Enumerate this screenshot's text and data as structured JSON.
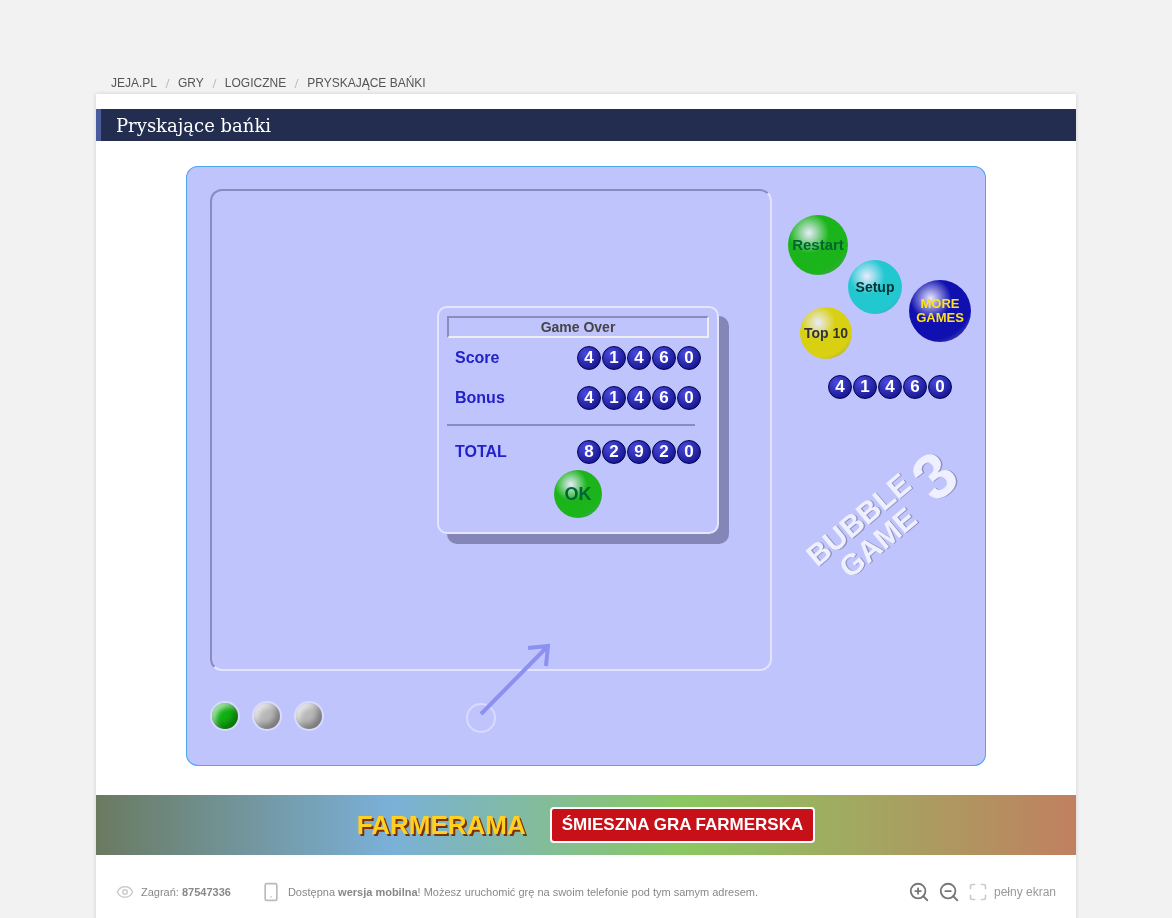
{
  "breadcrumbs": [
    "JEJA.PL",
    "GRY",
    "LOGICZNE",
    "PRYSKAJĄCE BAŃKI"
  ],
  "title": "Pryskające bańki",
  "game": {
    "dialog": {
      "title": "Game Over",
      "rows": [
        {
          "label": "Score",
          "digits": [
            "4",
            "1",
            "4",
            "6",
            "0"
          ]
        },
        {
          "label": "Bonus",
          "digits": [
            "4",
            "1",
            "4",
            "6",
            "0"
          ]
        },
        {
          "label": "TOTAL",
          "digits": [
            "8",
            "2",
            "9",
            "2",
            "0"
          ]
        }
      ],
      "ok": "OK"
    },
    "buttons": [
      {
        "label": "Restart",
        "color": "#1bb51b"
      },
      {
        "label": "Setup",
        "color": "#22c8d0"
      },
      {
        "label": "MORE GAMES",
        "color": "#1010b0"
      },
      {
        "label": "Top 10",
        "color": "#d8d010"
      }
    ],
    "score": [
      "4",
      "1",
      "4",
      "6",
      "0"
    ],
    "logo": [
      "BUBBLE",
      "GAME",
      "3"
    ],
    "lives": [
      {
        "color": "#11b011"
      },
      {
        "color": "#b8b8b8"
      },
      {
        "color": "#b8b8b8"
      }
    ]
  },
  "banner": {
    "brand": "FARMERAMA",
    "slogan": "ŚMIESZNA GRA FARMERSKA"
  },
  "footer": {
    "plays": "Zagrań: **87547336**",
    "mobile": "Dostępna **wersja mobilna**! Możesz uruchomić grę na swoim telefonie pod tym samym adresem.",
    "fullscreen": "pełny ekran"
  }
}
